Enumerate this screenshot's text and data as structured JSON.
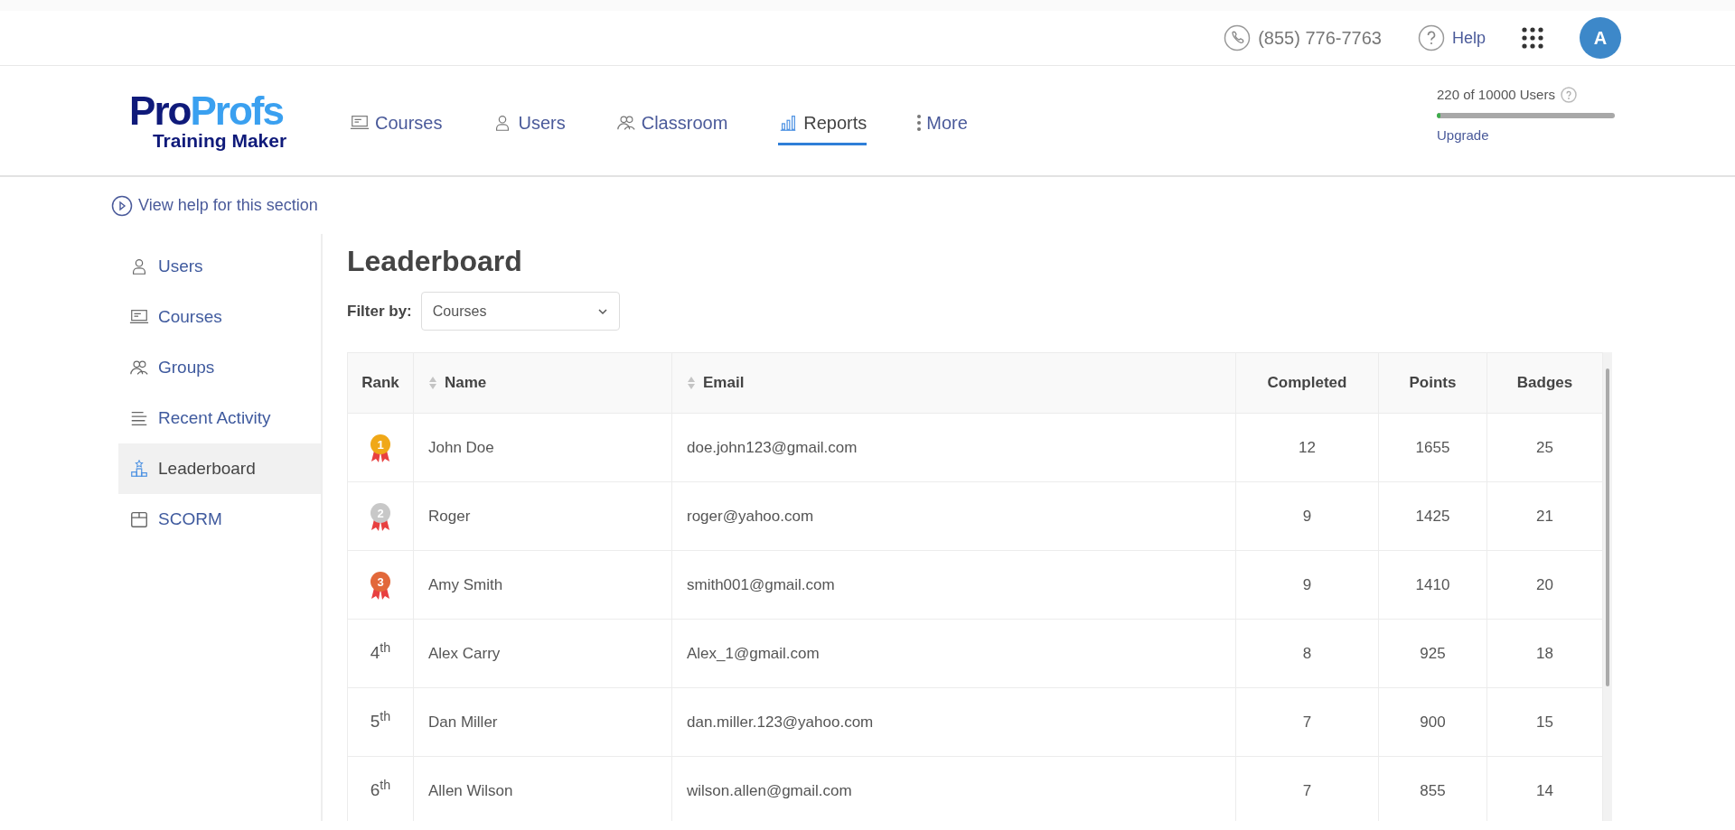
{
  "topbar": {
    "phone": "(855) 776-7763",
    "help": "Help",
    "avatar": "A"
  },
  "logo": {
    "brand_dark": "Pro",
    "brand_light": "Profs",
    "product": "Training Maker"
  },
  "nav": [
    {
      "label": "Courses",
      "kind": "laptop",
      "selected": false
    },
    {
      "label": "Users",
      "kind": "user",
      "selected": false
    },
    {
      "label": "Classroom",
      "kind": "group",
      "selected": false
    },
    {
      "label": "Reports",
      "kind": "chart",
      "selected": true
    },
    {
      "label": "More",
      "kind": "dots",
      "selected": false
    }
  ],
  "usage": {
    "text": "220 of 10000 Users",
    "level": 0.022,
    "link": "Upgrade"
  },
  "help_link": "View help for this section",
  "sidebar": [
    {
      "label": "Users",
      "kind": "user",
      "selected": false
    },
    {
      "label": "Courses",
      "kind": "laptop",
      "selected": false
    },
    {
      "label": "Groups",
      "kind": "group",
      "selected": false
    },
    {
      "label": "Recent Activity",
      "kind": "lines",
      "selected": false
    },
    {
      "label": "Leaderboard",
      "kind": "podium",
      "selected": true
    },
    {
      "label": "SCORM",
      "kind": "box",
      "selected": false
    }
  ],
  "title": "Leaderboard",
  "filter": {
    "label": "Filter by:",
    "value": "Courses"
  },
  "table": {
    "columns": [
      {
        "label": "Rank",
        "sortable": false
      },
      {
        "label": "Name",
        "sortable": true
      },
      {
        "label": "Email",
        "sortable": true
      },
      {
        "label": "Completed",
        "sortable": false
      },
      {
        "label": "Points",
        "sortable": false
      },
      {
        "label": "Badges",
        "sortable": false
      }
    ],
    "rows": [
      {
        "kind": "medal",
        "color": "#f0a818",
        "cells": [
          "1",
          "John Doe",
          "doe.john123@gmail.com",
          "12",
          "1655",
          "25"
        ]
      },
      {
        "kind": "medal",
        "color": "#c8c8c8",
        "cells": [
          "2",
          "Roger",
          "roger@yahoo.com",
          "9",
          "1425",
          "21"
        ]
      },
      {
        "kind": "medal",
        "color": "#e2683a",
        "cells": [
          "3",
          "Amy Smith",
          "smith001@gmail.com",
          "9",
          "1410",
          "20"
        ]
      },
      {
        "kind": "ordinal",
        "cells": [
          "4$^{th}$",
          "Alex Carry",
          "Alex_1@gmail.com",
          "8",
          "925",
          "18"
        ]
      },
      {
        "kind": "ordinal",
        "cells": [
          "5$^{th}$",
          "Dan Miller",
          "dan.miller.123@yahoo.com",
          "7",
          "900",
          "15"
        ]
      },
      {
        "kind": "ordinal",
        "cells": [
          "6$^{th}$",
          "Allen Wilson",
          "wilson.allen@gmail.com",
          "7",
          "855",
          "14"
        ]
      }
    ]
  }
}
